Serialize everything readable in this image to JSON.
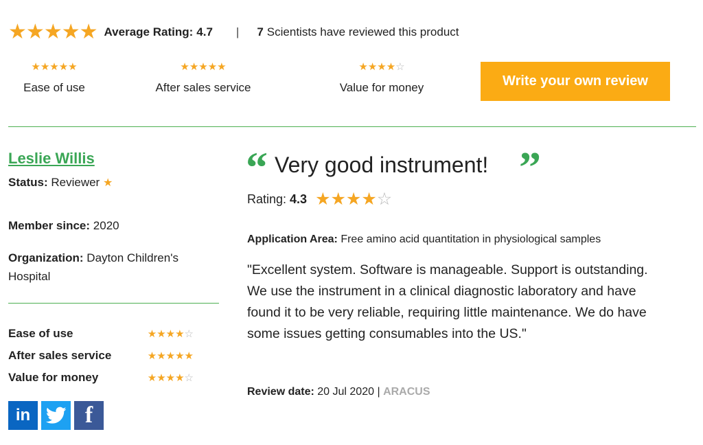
{
  "summary": {
    "overall_rating": 5,
    "avg_label": "Average Rating:",
    "avg_value": "4.7",
    "separator": "|",
    "count": "7",
    "count_text": "Scientists have reviewed this product"
  },
  "categories": [
    {
      "label": "Ease of use",
      "rating": 5
    },
    {
      "label": "After sales service",
      "rating": 5
    },
    {
      "label": "Value for money",
      "rating": 4
    }
  ],
  "write_review_label": "Write your own review",
  "reviewer": {
    "name": "Leslie Willis",
    "status_label": "Status:",
    "status_value": "Reviewer",
    "member_label": "Member since:",
    "member_value": "2020",
    "org_label": "Organization:",
    "org_value": "Dayton Children's Hospital",
    "ratings": [
      {
        "label": "Ease of use",
        "rating": 4
      },
      {
        "label": "After sales service",
        "rating": 5
      },
      {
        "label": "Value for money",
        "rating": 4
      }
    ]
  },
  "review": {
    "title": "Very good instrument!",
    "rating_label": "Rating:",
    "rating_value": "4.3",
    "rating_stars": 4,
    "app_area_label": "Application Area:",
    "app_area_value": "Free amino acid quantitation in physiological samples",
    "body": "\"Excellent system. Software is manageable. Support is outstanding. We use the instrument in a clinical diagnostic laboratory and have found it to be very reliable, requiring little maintenance. We do have some issues getting consumables into the US.\"",
    "date_label": "Review date:",
    "date_value": "20 Jul 2020",
    "date_sep": "|",
    "product": "ARACUS"
  },
  "social": [
    {
      "name": "linkedin-icon",
      "glyph": "in"
    },
    {
      "name": "twitter-icon",
      "glyph": ""
    },
    {
      "name": "facebook-icon",
      "glyph": "f"
    }
  ],
  "colors": {
    "star": "#f5a623",
    "accent_green": "#3aa655",
    "button": "#fbab14"
  }
}
